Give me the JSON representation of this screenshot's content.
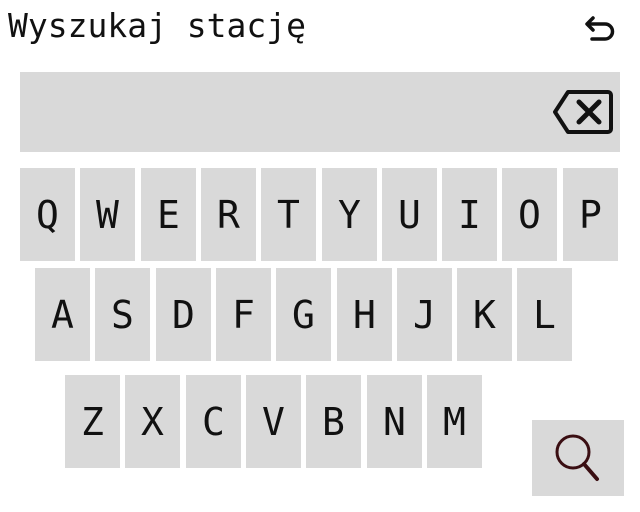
{
  "header": {
    "title": "Wyszukaj stację",
    "back_icon": "undo-arrow-icon"
  },
  "search": {
    "value": "",
    "backspace_icon": "backspace-icon"
  },
  "keyboard": {
    "rows": [
      [
        "Q",
        "W",
        "E",
        "R",
        "T",
        "Y",
        "U",
        "I",
        "O",
        "P"
      ],
      [
        "A",
        "S",
        "D",
        "F",
        "G",
        "H",
        "J",
        "K",
        "L"
      ],
      [
        "Z",
        "X",
        "C",
        "V",
        "B",
        "N",
        "M"
      ]
    ],
    "search_icon": "search-icon"
  },
  "colors": {
    "key_background": "#d9d9d9",
    "text": "#111111",
    "search_icon_accent": "#3a0e12"
  }
}
